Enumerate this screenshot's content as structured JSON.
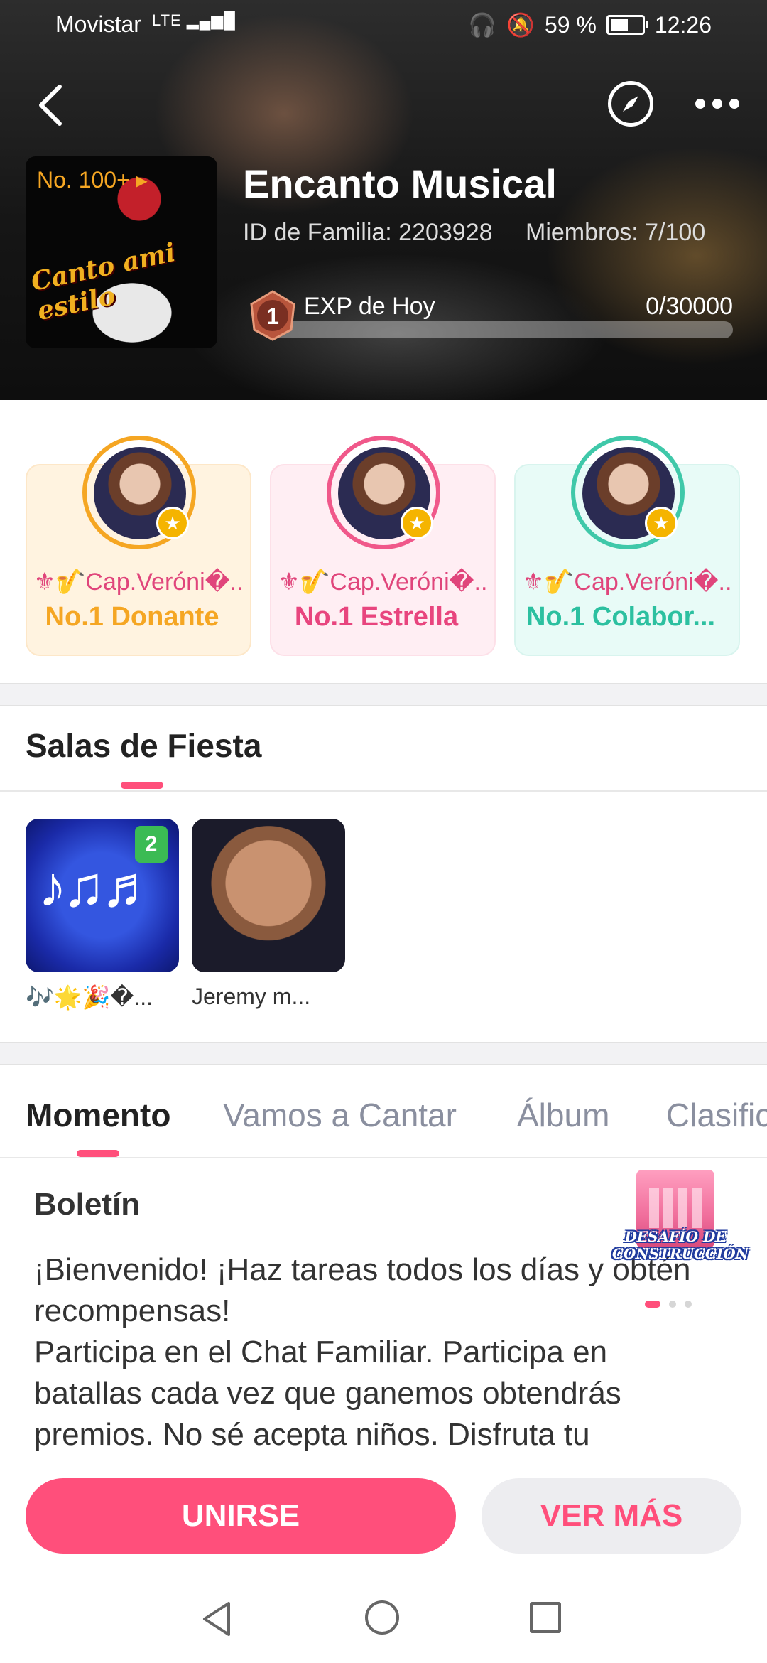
{
  "status_bar": {
    "carrier": "Movistar",
    "signal": "LTE",
    "battery": "59 %",
    "time": "12:26"
  },
  "header": {
    "family_name": "Encanto Musical",
    "family_id": "ID de Familia: 2203928",
    "members": "Miembros: 7/100",
    "rank": "No. 100+",
    "logo_text": "Canto ami estilo",
    "level": "1",
    "exp_label": "EXP de Hoy",
    "exp_value": "0/30000",
    "exp_progress": 0
  },
  "top_members": [
    {
      "name": "⚜🎷Cap.Veróni�..",
      "title": "No.1 Donante"
    },
    {
      "name": "⚜🎷Cap.Veróni�..",
      "title": "No.1 Estrella"
    },
    {
      "name": "⚜🎷Cap.Veróni�..",
      "title": "No.1 Colabor..."
    }
  ],
  "party_rooms": {
    "title": "Salas de Fiesta",
    "rooms": [
      {
        "name": "🎶🌟🎉�...",
        "badge": "2"
      },
      {
        "name": "Jeremy m..."
      }
    ]
  },
  "tabs": [
    "Momento",
    "Vamos a Cantar",
    "Álbum",
    "Clasificación"
  ],
  "bulletin": {
    "title": "Boletín",
    "lines": [
      "¡Bienvenido! ¡Haz tareas todos los días y obtén recompensas!",
      "Participa en el Chat Familiar.  Participa en batallas cada vez que ganemos obtendrás premios. No sé acepta niños. Disfruta tu"
    ],
    "promo_label": "DESAFÍO DE CONSTRUCCIÓN"
  },
  "actions": {
    "join": "UNIRSE",
    "more": "VER MÁS"
  },
  "colors": {
    "accent": "#ff4f7b",
    "gold": "#f5a623",
    "pink": "#e8457e",
    "teal": "#2cc0a0"
  }
}
